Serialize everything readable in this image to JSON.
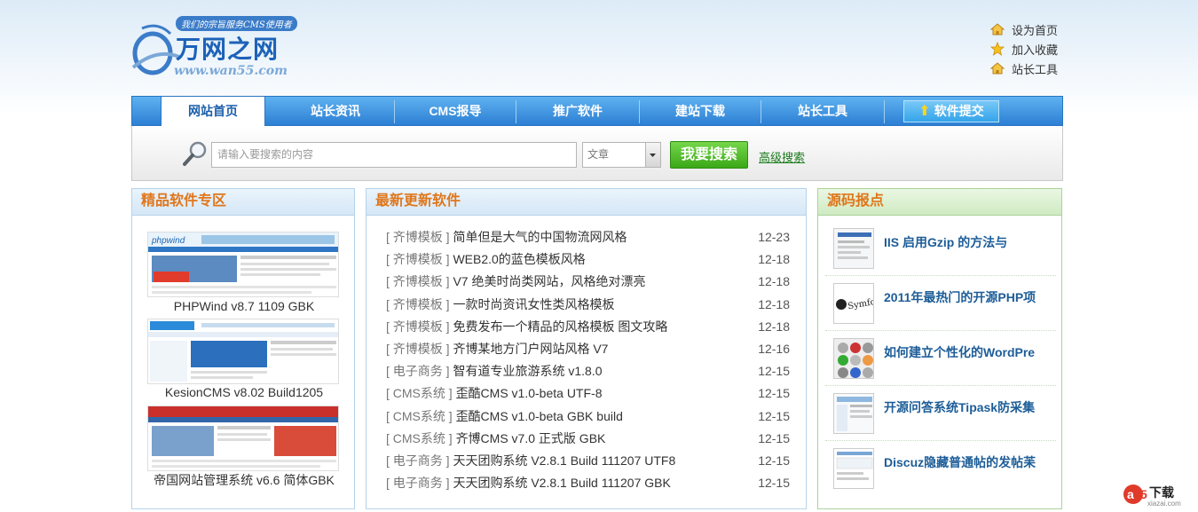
{
  "header": {
    "logo_slogan": "我们的宗旨服务CMS使用者",
    "logo_name": "万网之网",
    "logo_url": "www.wan55.com",
    "toplinks": [
      {
        "label": "设为首页",
        "icon": "home-icon"
      },
      {
        "label": "加入收藏",
        "icon": "star-icon"
      },
      {
        "label": "站长工具",
        "icon": "home-icon"
      }
    ]
  },
  "nav": {
    "items": [
      "网站首页",
      "站长资讯",
      "CMS报导",
      "推广软件",
      "建站下载",
      "站长工具"
    ],
    "submit": "软件提交",
    "active_index": 0
  },
  "search": {
    "placeholder": "请输入要搜索的内容",
    "select_value": "文章",
    "button": "我要搜索",
    "advanced": "高级搜索"
  },
  "featured": {
    "title": "精品软件专区",
    "items": [
      {
        "caption": "PHPWind v8.7 1109 GBK"
      },
      {
        "caption": "KesionCMS v8.02 Build1205"
      },
      {
        "caption": "帝国网站管理系统 v6.6 简体GBK"
      }
    ]
  },
  "latest": {
    "title": "最新更新软件",
    "rows": [
      {
        "cat": "[ 齐博模板 ]",
        "title": "简单但是大气的中国物流网风格",
        "date": "12-23"
      },
      {
        "cat": "[ 齐博模板 ]",
        "title": "WEB2.0的蓝色模板风格",
        "date": "12-18"
      },
      {
        "cat": "[ 齐博模板 ]",
        "title": "V7 绝美时尚类网站，风格绝对漂亮",
        "date": "12-18"
      },
      {
        "cat": "[ 齐博模板 ]",
        "title": "一款时尚资讯女性类风格模板",
        "date": "12-18"
      },
      {
        "cat": "[ 齐博模板 ]",
        "title": "免费发布一个精品的风格模板 图文攻略",
        "date": "12-18"
      },
      {
        "cat": "[ 齐博模板 ]",
        "title": "齐博某地方门户网站风格 V7",
        "date": "12-16"
      },
      {
        "cat": "[ 电子商务 ]",
        "title": "智有道专业旅游系统 v1.8.0",
        "date": "12-15"
      },
      {
        "cat": "[ CMS系统 ]",
        "title": "歪酷CMS v1.0-beta UTF-8",
        "date": "12-15"
      },
      {
        "cat": "[ CMS系统 ]",
        "title": "歪酷CMS v1.0-beta GBK build",
        "date": "12-15"
      },
      {
        "cat": "[ CMS系统 ]",
        "title": "齐博CMS v7.0 正式版 GBK",
        "date": "12-15"
      },
      {
        "cat": "[ 电子商务 ]",
        "title": "天天团购系统 V2.8.1 Build 111207 UTF8",
        "date": "12-15"
      },
      {
        "cat": "[ 电子商务 ]",
        "title": "天天团购系统 V2.8.1 Build 111207 GBK",
        "date": "12-15"
      }
    ]
  },
  "news": {
    "title": "源码报点",
    "items": [
      {
        "title": "IIS 启用Gzip 的方法与"
      },
      {
        "title": "2011年最热门的开源PHP项"
      },
      {
        "title": "如何建立个性化的WordPre"
      },
      {
        "title": "开源问答系统Tipask防采集"
      },
      {
        "title": "Discuz隐藏普通帖的发帖苿"
      }
    ],
    "thumb_labels": {
      "symfony": "Symfony"
    }
  },
  "badge": {
    "main": "下载",
    "sub": "xiazai.com"
  },
  "colors": {
    "nav": "#2c7fd3",
    "accent": "#e0761b",
    "link": "#1d5d98",
    "search_btn": "#3aa817"
  }
}
